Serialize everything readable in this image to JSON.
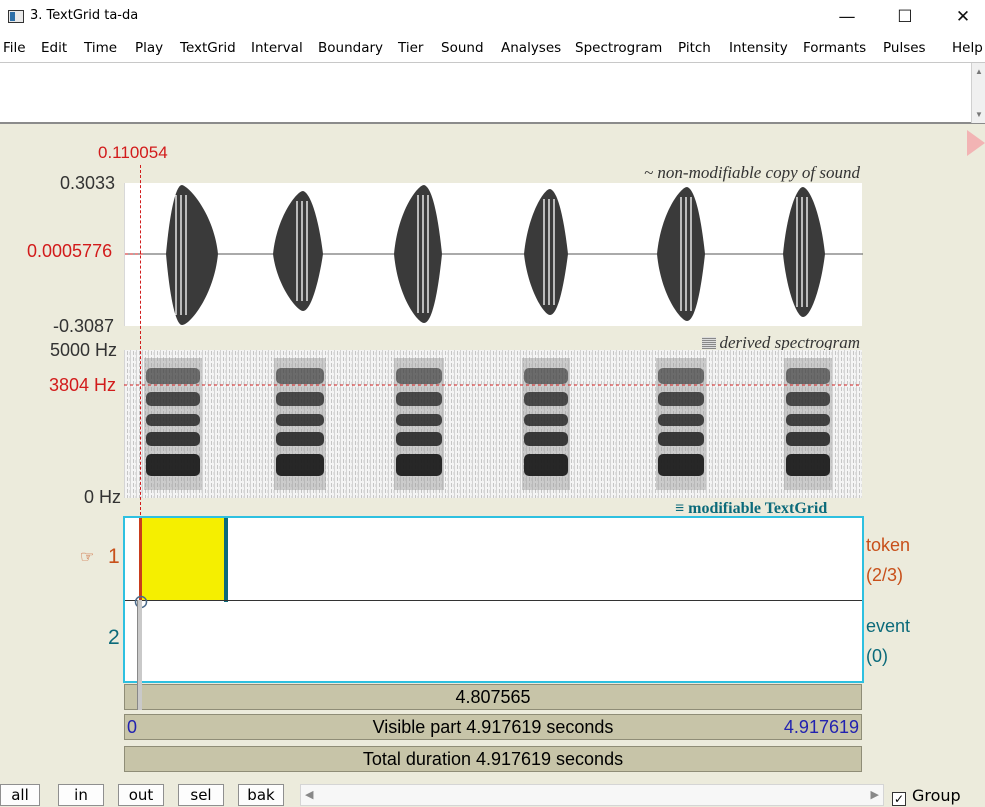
{
  "window": {
    "title": "3. TextGrid ta-da",
    "minimize": "—",
    "maximize": "☐",
    "close": "✕"
  },
  "menu": [
    "File",
    "Edit",
    "Time",
    "Play",
    "TextGrid",
    "Interval",
    "Boundary",
    "Tier",
    "Sound",
    "Analyses",
    "Spectrogram",
    "Pitch",
    "Intensity",
    "Formants",
    "Pulses",
    "Help"
  ],
  "cursor": {
    "time": "0.110054",
    "amplitude": "0.0005776",
    "frequency": "3804 Hz"
  },
  "waveform": {
    "max_label": "0.3033",
    "min_label": "-0.3087",
    "title": "~ non-modifiable copy of sound"
  },
  "spectrogram": {
    "top_label": "5000 Hz",
    "bottom_label": "0 Hz",
    "title": "derived spectrogram"
  },
  "textgrid": {
    "title": "modifiable TextGrid",
    "tiers": [
      {
        "number": "1",
        "name": "token",
        "count": "(2/3)"
      },
      {
        "number": "2",
        "name": "event",
        "count": "(0)"
      }
    ]
  },
  "bars": {
    "selection_duration": "4.807565",
    "visible_start": "0",
    "visible_label": "Visible part 4.917619 seconds",
    "visible_end": "4.917619",
    "total_label": "Total duration 4.917619 seconds"
  },
  "bottom": {
    "buttons": [
      "all",
      "in",
      "out",
      "sel",
      "bak"
    ],
    "group_label": "Group",
    "group_checked": true
  },
  "colors": {
    "cursor": "#d21b1b",
    "selection": "#f5ef00",
    "textgrid_frame": "#2ec0e0",
    "bar": "#c7c4a8"
  }
}
